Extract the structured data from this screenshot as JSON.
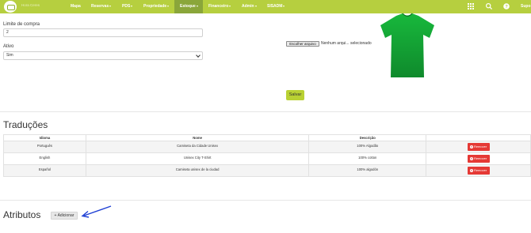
{
  "navbar": {
    "brand": "Hora Ceres",
    "items": [
      {
        "label": "Mapa",
        "caret": false
      },
      {
        "label": "Reservas",
        "caret": true
      },
      {
        "label": "PDS",
        "caret": true
      },
      {
        "label": "Propriedade",
        "caret": true
      },
      {
        "label": "Estoque",
        "caret": true,
        "active": true
      },
      {
        "label": "Financeiro",
        "caret": true
      },
      {
        "label": "Admin",
        "caret": true
      },
      {
        "label": "SISADM",
        "caret": true
      }
    ],
    "right_link": "Supo",
    "icons": [
      "grid-icon",
      "search-icon",
      "help-icon"
    ]
  },
  "form": {
    "purchase_limit_label": "Limite de compra",
    "purchase_limit_value": "2",
    "active_label": "Ativo",
    "active_value": "Sim",
    "file_button": "Escolher arquivo",
    "file_status": "Nenhum arqui... selecionado",
    "save_button": "Salvar",
    "product_image_color": "#14a83a"
  },
  "translations": {
    "title": "Traduções",
    "headers": [
      "Idioma",
      "Nome",
      "Descrição",
      ""
    ],
    "rows": [
      {
        "language": "Português",
        "name": "Camiseta da Cidade Unisex",
        "description": "100% Algodão",
        "action": "Remover"
      },
      {
        "language": "English",
        "name": "Unisex City T-Shirt",
        "description": "100% cotton",
        "action": "Remover"
      },
      {
        "language": "Español",
        "name": "Camiseta unisex de la ciudad",
        "description": "100% algodón",
        "action": "Remover"
      }
    ]
  },
  "attributes": {
    "title": "Atributos",
    "add_button": "+ Adicionar"
  },
  "colors": {
    "navbar": "#b6cf3f",
    "navbar_active": "#8aa63a",
    "save_button": "#b9d133",
    "remove_button": "#e53935",
    "arrow": "#1e3fd4"
  }
}
